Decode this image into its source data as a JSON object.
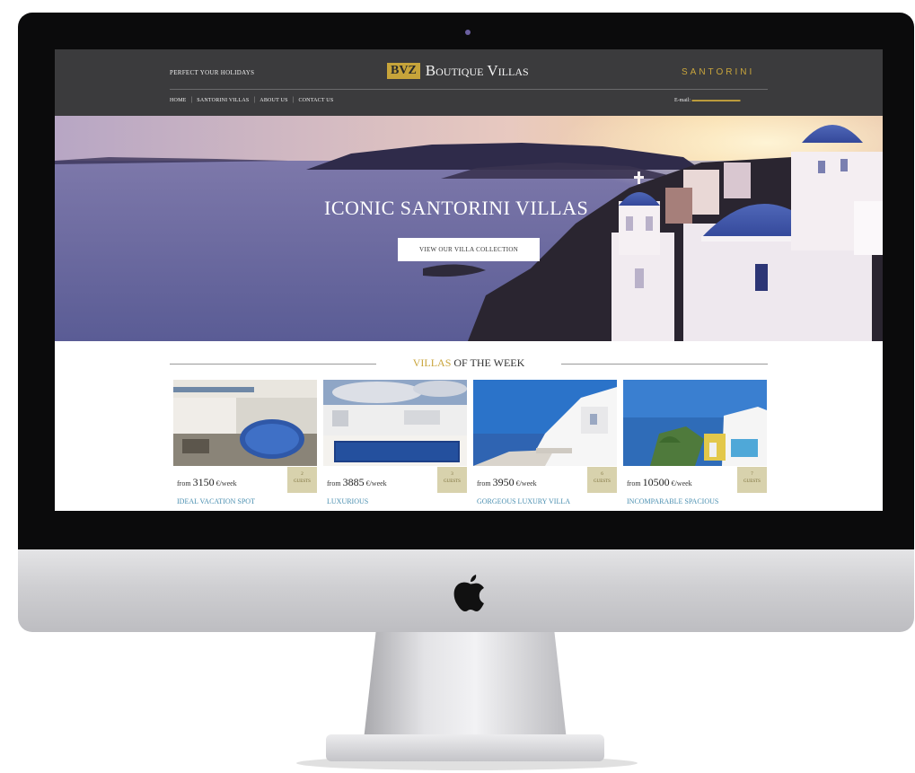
{
  "header": {
    "tagline": "PERFECT YOUR HOLIDAYS",
    "logo_mark": "BVZ",
    "logo_text": "Boutique Villas",
    "location": "SANTORINI",
    "nav": [
      "HOME",
      "SANTORINI VILLAS",
      "ABOUT US",
      "CONTACT US"
    ],
    "email_label": "E-mail:"
  },
  "hero": {
    "title": "ICONIC SANTORINI VILLAS",
    "button": "VIEW OUR VILLA COLLECTION"
  },
  "section": {
    "heading_accent": "VILLAS",
    "heading_rest": " OF THE WEEK"
  },
  "villas": [
    {
      "from": "from",
      "price": "3150",
      "unit": "€/week",
      "guests_count": "2",
      "guests_label": "GUESTS",
      "name": "IDEAL VACATION SPOT"
    },
    {
      "from": "from",
      "price": "3885",
      "unit": "€/week",
      "guests_count": "3",
      "guests_label": "GUESTS",
      "name": "LUXURIOUS"
    },
    {
      "from": "from",
      "price": "3950",
      "unit": "€/week",
      "guests_count": "6",
      "guests_label": "GUESTS",
      "name": "GORGEOUS LUXURY VILLA"
    },
    {
      "from": "from",
      "price": "10500",
      "unit": "€/week",
      "guests_count": "7",
      "guests_label": "GUESTS",
      "name": "INCOMPARABLE SPACIOUS"
    }
  ],
  "colors": {
    "header_bg": "#3b3b3d",
    "accent_gold": "#c9a53c",
    "villa_name_blue": "#4a8fb0",
    "guests_badge": "#d8d2ad"
  },
  "icons": {
    "brand": "apple-logo-icon"
  }
}
